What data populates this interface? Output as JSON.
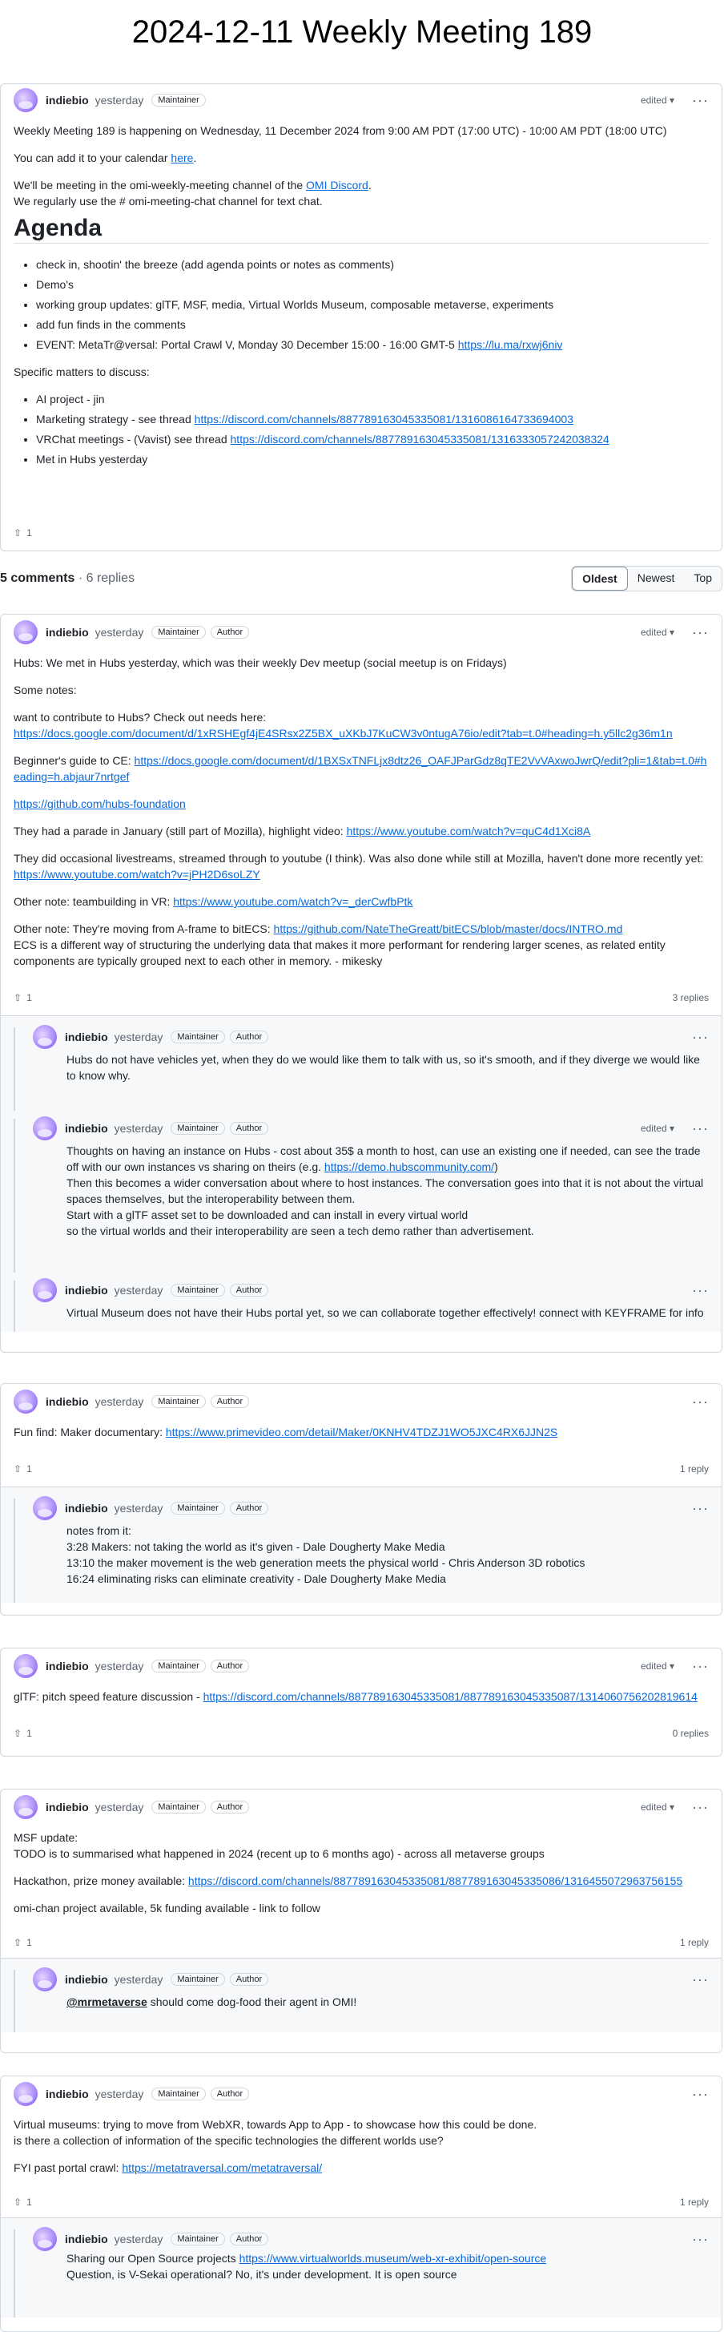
{
  "page": {
    "title": "2024-12-11 Weekly Meeting 189"
  },
  "main_post": {
    "author": "indiebio",
    "time": "yesterday",
    "badges": [
      "Maintainer"
    ],
    "edited": "edited",
    "intro": "Weekly Meeting 189 is happening on Wednesday, 11 December 2024 from 9:00 AM PDT (17:00 UTC) - 10:00 AM PDT (18:00 UTC)",
    "calendar_pre": "You can add it to your calendar ",
    "calendar_link": "here",
    "calendar_post": ".",
    "discord_pre": "We'll be meeting in the omi-weekly-meeting channel of the ",
    "discord_link": "OMI Discord",
    "discord_post": ".",
    "chat_line": "We regularly use the # omi-meeting-chat channel for text chat.",
    "agenda_heading": "Agenda",
    "agenda_items": [
      "check in, shootin' the breeze (add agenda points or notes as comments)",
      "Demo's",
      "working group updates: glTF, MSF, media, Virtual Worlds Museum, composable metaverse, experiments",
      "add fun finds in the comments"
    ],
    "event_pre": "EVENT: MetaTr@versal: Portal Crawl V, Monday 30 December 15:00 - 16:00 GMT-5 ",
    "event_link": "https://lu.ma/rxwj6niv",
    "specific_heading": "Specific matters to discuss:",
    "specific_1": "AI project - jin",
    "specific_2_pre": "Marketing strategy - see thread ",
    "specific_2_link": "https://discord.com/channels/887789163045335081/1316086164733694003",
    "specific_3_pre": "VRChat meetings - (Vavist) see thread ",
    "specific_3_link": "https://discord.com/channels/887789163045335081/1316333057242038324",
    "specific_4": "Met in Hubs yesterday",
    "upvotes": "1"
  },
  "summary": {
    "comments": "5 comments",
    "replies": "· 6 replies",
    "tabs": [
      "Oldest",
      "Newest",
      "Top"
    ]
  },
  "c1": {
    "author": "indiebio",
    "time": "yesterday",
    "badges": [
      "Maintainer",
      "Author"
    ],
    "edited": "edited",
    "p1": "Hubs: We met in Hubs yesterday, which was their weekly Dev meetup (social meetup is on Fridays)",
    "p2": "Some notes:",
    "p3": "want to contribute to Hubs? Check out needs here:",
    "p3_link": "https://docs.google.com/document/d/1xRSHEgf4jE4SRsx2Z5BX_uXKbJ7KuCW3v0ntugA76io/edit?tab=t.0#heading=h.y5llc2g36m1n",
    "p4_pre": "Beginner's guide to CE: ",
    "p4_link": "https://docs.google.com/document/d/1BXSxTNFLjx8dtz26_OAFJParGdz8qTE2VvVAxwoJwrQ/edit?pli=1&tab=t.0#heading=h.abjaur7nrtgef",
    "p5_link": "https://github.com/hubs-foundation",
    "p6_pre": "They had a parade in January (still part of Mozilla), highlight video: ",
    "p6_link": "https://www.youtube.com/watch?v=quC4d1Xci8A",
    "p7_pre": "They did occasional livestreams, streamed through to youtube (I think). Was also done while still at Mozilla, haven't done more recently yet: ",
    "p7_link": "https://www.youtube.com/watch?v=jPH2D6soLZY",
    "p8_pre": "Other note: teambuilding in VR: ",
    "p8_link": "https://www.youtube.com/watch?v=_derCwfbPtk",
    "p9_pre": "Other note: They're moving from A-frame to bitECS: ",
    "p9_link": "https://github.com/NateTheGreatt/bitECS/blob/master/docs/INTRO.md",
    "p9_post": "ECS is a different way of structuring the underlying data that makes it more performant for rendering larger scenes, as related entity components are typically grouped next to each other in memory. - mikesky",
    "upvotes": "1",
    "replies": "3 replies"
  },
  "r1": {
    "author": "indiebio",
    "time": "yesterday",
    "badges": [
      "Maintainer",
      "Author"
    ],
    "text": "Hubs do not have vehicles yet, when they do we would like them to talk with us, so it's smooth, and if they diverge we would like to know why."
  },
  "r2": {
    "author": "indiebio",
    "time": "yesterday",
    "badges": [
      "Maintainer",
      "Author"
    ],
    "edited": "edited",
    "l1_pre": "Thoughts on having an instance on Hubs - cost about 35$ a month to host, can use an existing one if needed, can see the trade off with our own instances vs sharing on theirs (e.g. ",
    "l1_link": "https://demo.hubscommunity.com/",
    "l1_post": ")",
    "l2": "Then this becomes a wider conversation about where to host instances. The conversation goes into that it is not about the virtual spaces themselves, but the interoperability between them.",
    "l3": "Start with a glTF asset set to be downloaded and can install in every virtual world",
    "l4": "so the virtual worlds and their interoperability are seen a tech demo rather than advertisement."
  },
  "r3": {
    "author": "indiebio",
    "time": "yesterday",
    "badges": [
      "Maintainer",
      "Author"
    ],
    "text": "Virtual Museum does not have their Hubs portal yet, so we can collaborate together effectively! connect with KEYFRAME for info"
  },
  "c2": {
    "author": "indiebio",
    "time": "yesterday",
    "badges": [
      "Maintainer",
      "Author"
    ],
    "text_pre": "Fun find: Maker documentary: ",
    "text_link": "https://www.primevideo.com/detail/Maker/0KNHV4TDZJ1WO5JXC4RX6JJN2S",
    "upvotes": "1",
    "replies": "1 reply"
  },
  "r4": {
    "author": "indiebio",
    "time": "yesterday",
    "badges": [
      "Maintainer",
      "Author"
    ],
    "l1": "notes from it:",
    "l2": "3:28 Makers: not taking the world as it's given - Dale Dougherty Make Media",
    "l3": "13:10 the maker movement is the web generation meets the physical world - Chris Anderson 3D robotics",
    "l4": "16:24 eliminating risks can eliminate creativity - Dale Dougherty Make Media"
  },
  "c3": {
    "author": "indiebio",
    "time": "yesterday",
    "badges": [
      "Maintainer",
      "Author"
    ],
    "edited": "edited",
    "text_pre": "glTF: pitch speed feature discussion - ",
    "text_link": "https://discord.com/channels/887789163045335081/887789163045335087/1314060756202819614",
    "upvotes": "1",
    "replies": "0 replies"
  },
  "c4": {
    "author": "indiebio",
    "time": "yesterday",
    "badges": [
      "Maintainer",
      "Author"
    ],
    "edited": "edited",
    "l1": "MSF update:",
    "l2": "TODO is to summarised what happened in 2024 (recent up to 6 months ago) - across all metaverse groups",
    "l3_pre": "Hackathon, prize money available: ",
    "l3_link": "https://discord.com/channels/887789163045335081/887789163045335086/1316455072963756155",
    "l4": "omi-chan project available, 5k funding available - link to follow",
    "upvotes": "1",
    "replies": "1 reply"
  },
  "r5": {
    "author": "indiebio",
    "time": "yesterday",
    "badges": [
      "Maintainer",
      "Author"
    ],
    "mention": "@mrmetaverse",
    "text": " should come dog-food their agent in OMI!"
  },
  "c5": {
    "author": "indiebio",
    "time": "yesterday",
    "badges": [
      "Maintainer",
      "Author"
    ],
    "l1": "Virtual museums: trying to move from WebXR, towards App to App - to showcase how this could be done.",
    "l2": "is there a collection of information of the specific technologies the different worlds use?",
    "l3_pre": "FYI past portal crawl: ",
    "l3_link": "https://metatraversal.com/metatraversal/",
    "upvotes": "1",
    "replies": "1 reply"
  },
  "r6": {
    "author": "indiebio",
    "time": "yesterday",
    "badges": [
      "Maintainer",
      "Author"
    ],
    "l1_pre": "Sharing our Open Source projects ",
    "l1_link": "https://www.virtualworlds.museum/web-xr-exhibit/open-source",
    "l2": "Question, is V-Sekai operational? No, it's under development. It is open source"
  }
}
